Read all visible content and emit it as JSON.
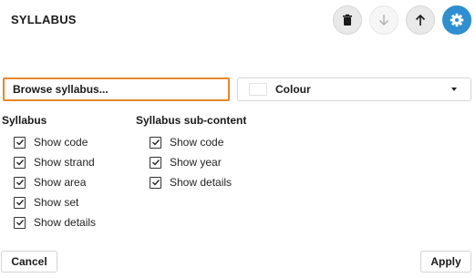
{
  "header": {
    "title": "SYLLABUS"
  },
  "toolbar": {
    "delete_icon": "trash-icon",
    "down_icon": "arrow-down-icon",
    "up_icon": "arrow-up-icon",
    "settings_icon": "gear-icon",
    "settings_color": "#2f8fd0"
  },
  "browse": {
    "label": "Browse syllabus..."
  },
  "colour": {
    "label": "Colour"
  },
  "syllabus": {
    "title": "Syllabus",
    "options": [
      {
        "label": "Show code",
        "checked": true
      },
      {
        "label": "Show strand",
        "checked": true
      },
      {
        "label": "Show area",
        "checked": true
      },
      {
        "label": "Show set",
        "checked": true
      },
      {
        "label": "Show details",
        "checked": true
      }
    ]
  },
  "subcontent": {
    "title": "Syllabus sub-content",
    "options": [
      {
        "label": "Show code",
        "checked": true
      },
      {
        "label": "Show year",
        "checked": true
      },
      {
        "label": "Show details",
        "checked": true
      }
    ]
  },
  "footer": {
    "cancel_label": "Cancel",
    "apply_label": "Apply"
  }
}
